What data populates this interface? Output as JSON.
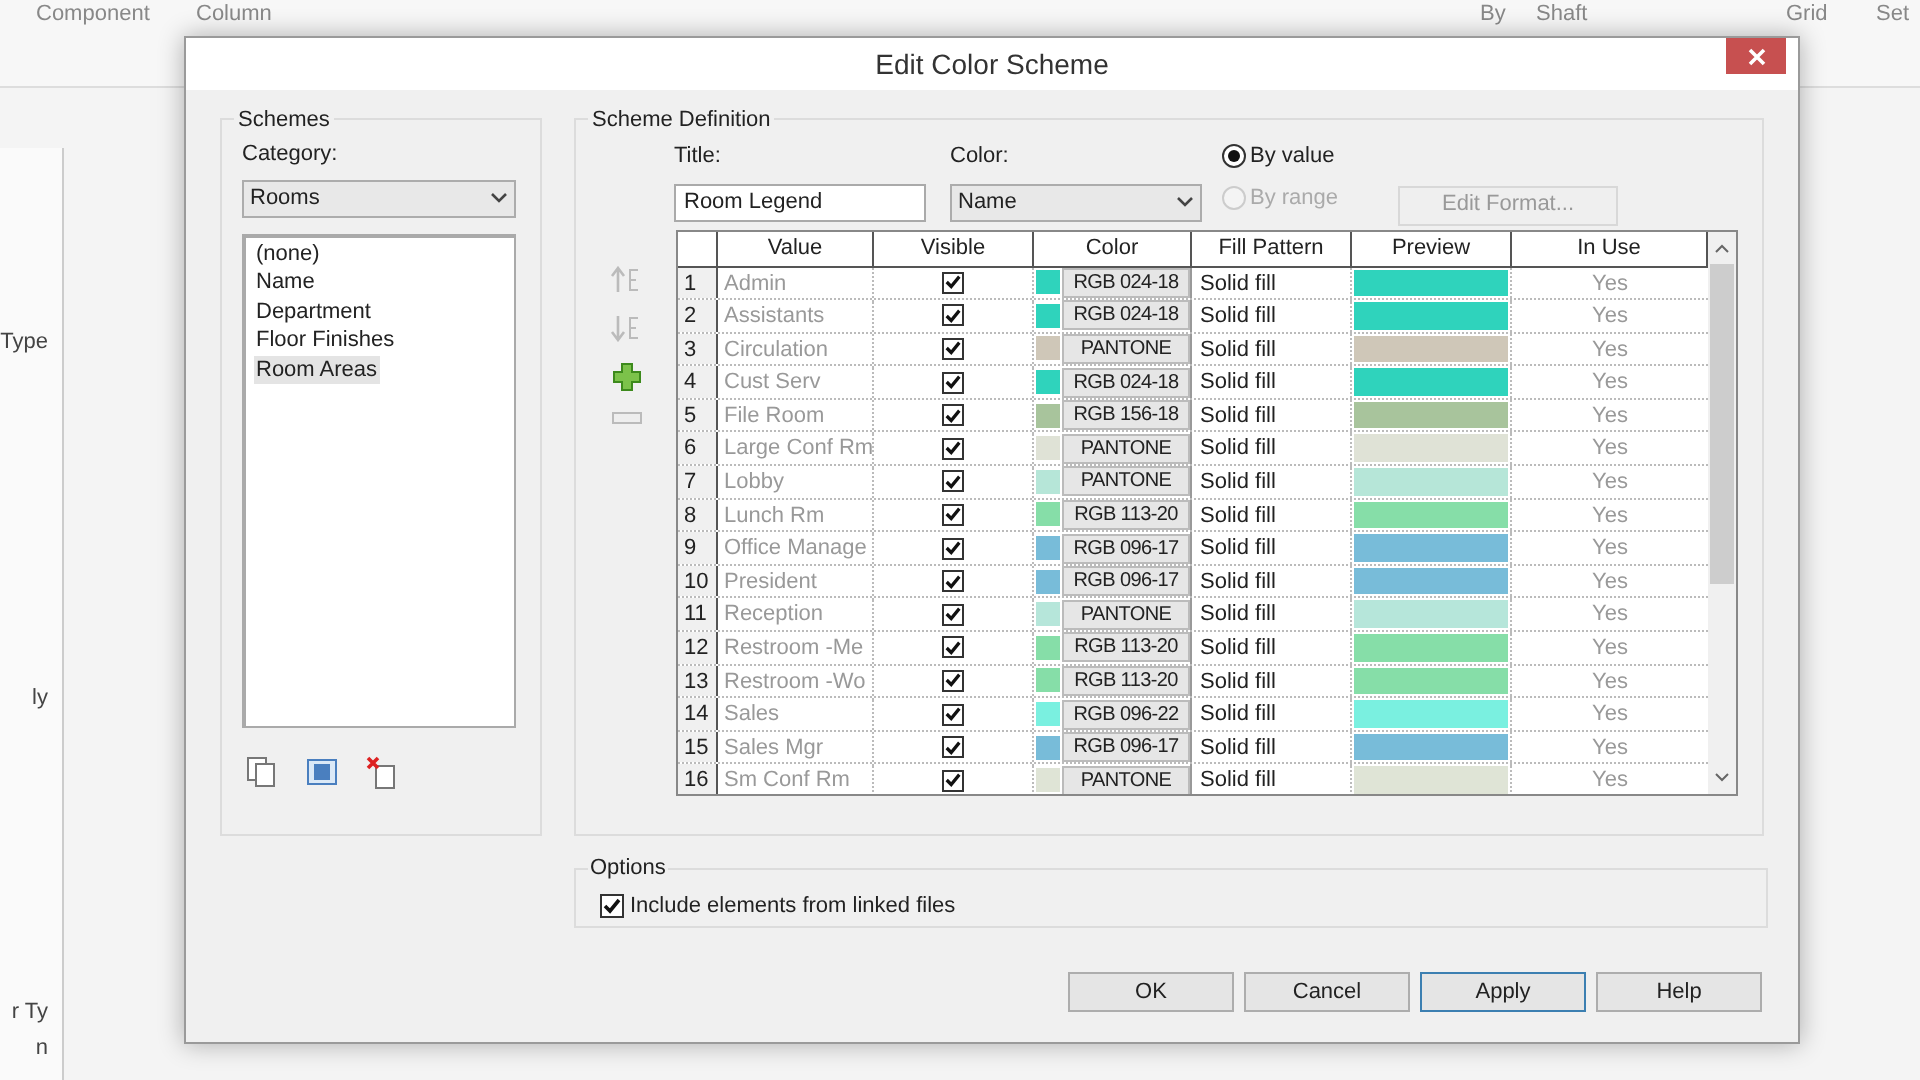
{
  "background": {
    "ribbon_labels": [
      "Component",
      "Column",
      "By",
      "Shaft",
      "Grid",
      "Set"
    ],
    "panel_texts": [
      "Type",
      "ly",
      "r Ty",
      "n"
    ]
  },
  "window": {
    "title": "Edit Color Scheme"
  },
  "schemes": {
    "heading": "Schemes",
    "category_label": "Category:",
    "category": "Rooms",
    "items": [
      {
        "label": "(none)",
        "selected": false
      },
      {
        "label": "Name",
        "selected": false
      },
      {
        "label": "Department",
        "selected": false
      },
      {
        "label": "Floor Finishes",
        "selected": false
      },
      {
        "label": "Room Areas",
        "selected": true
      }
    ]
  },
  "definition": {
    "heading": "Scheme Definition",
    "title_label": "Title:",
    "title_value": "Room Legend",
    "color_label": "Color:",
    "color_value": "Name",
    "modes": [
      {
        "label": "By value",
        "selected": true,
        "disabled": false
      },
      {
        "label": "By range",
        "selected": false,
        "disabled": true
      }
    ],
    "edit_format": {
      "label": "Edit Format...",
      "disabled": true
    },
    "columns": [
      "Value",
      "Visible",
      "Color",
      "Fill Pattern",
      "Preview",
      "In Use"
    ],
    "rows": [
      {
        "number": "1",
        "value": "Admin",
        "visible": true,
        "color_code": "RGB 024-18",
        "color": "#2fd3bc",
        "fill": "Solid fill",
        "in_use": "Yes"
      },
      {
        "number": "2",
        "value": "Assistants",
        "visible": true,
        "color_code": "RGB 024-18",
        "color": "#2fd3bc",
        "fill": "Solid fill",
        "in_use": "Yes"
      },
      {
        "number": "3",
        "value": "Circulation",
        "visible": true,
        "color_code": "PANTONE",
        "color": "#cfc7b8",
        "fill": "Solid fill",
        "in_use": "Yes"
      },
      {
        "number": "4",
        "value": "Cust Serv",
        "visible": true,
        "color_code": "RGB 024-18",
        "color": "#2fd3bc",
        "fill": "Solid fill",
        "in_use": "Yes"
      },
      {
        "number": "5",
        "value": "File Room",
        "visible": true,
        "color_code": "RGB 156-18",
        "color": "#a8c49c",
        "fill": "Solid fill",
        "in_use": "Yes"
      },
      {
        "number": "6",
        "value": "Large Conf Rm",
        "visible": true,
        "color_code": "PANTONE",
        "color": "#dfe2d6",
        "fill": "Solid fill",
        "in_use": "Yes"
      },
      {
        "number": "7",
        "value": "Lobby",
        "visible": true,
        "color_code": "PANTONE",
        "color": "#b6e6d8",
        "fill": "Solid fill",
        "in_use": "Yes"
      },
      {
        "number": "8",
        "value": "Lunch Rm",
        "visible": true,
        "color_code": "RGB 113-20",
        "color": "#86dea8",
        "fill": "Solid fill",
        "in_use": "Yes"
      },
      {
        "number": "9",
        "value": "Office Manage",
        "visible": true,
        "color_code": "RGB 096-17",
        "color": "#78bcd9",
        "fill": "Solid fill",
        "in_use": "Yes"
      },
      {
        "number": "10",
        "value": "President",
        "visible": true,
        "color_code": "RGB 096-17",
        "color": "#78bcd9",
        "fill": "Solid fill",
        "in_use": "Yes"
      },
      {
        "number": "11",
        "value": "Reception",
        "visible": true,
        "color_code": "PANTONE",
        "color": "#b6e6da",
        "fill": "Solid fill",
        "in_use": "Yes"
      },
      {
        "number": "12",
        "value": "Restroom -Me",
        "visible": true,
        "color_code": "RGB 113-20",
        "color": "#86dea8",
        "fill": "Solid fill",
        "in_use": "Yes"
      },
      {
        "number": "13",
        "value": "Restroom -Wo",
        "visible": true,
        "color_code": "RGB 113-20",
        "color": "#86dea8",
        "fill": "Solid fill",
        "in_use": "Yes"
      },
      {
        "number": "14",
        "value": "Sales",
        "visible": true,
        "color_code": "RGB 096-22",
        "color": "#7af0e0",
        "fill": "Solid fill",
        "in_use": "Yes"
      },
      {
        "number": "15",
        "value": "Sales Mgr",
        "visible": true,
        "color_code": "RGB 096-17",
        "color": "#78bcd9",
        "fill": "Solid fill",
        "in_use": "Yes"
      },
      {
        "number": "16",
        "value": "Sm Conf Rm",
        "visible": true,
        "color_code": "PANTONE",
        "color": "#dfe4d6",
        "fill": "Solid fill",
        "in_use": "Yes"
      }
    ]
  },
  "options": {
    "heading": "Options",
    "include_linked": {
      "label": "Include elements from linked files",
      "checked": true
    }
  },
  "buttons": [
    "OK",
    "Cancel",
    "Apply",
    "Help"
  ]
}
